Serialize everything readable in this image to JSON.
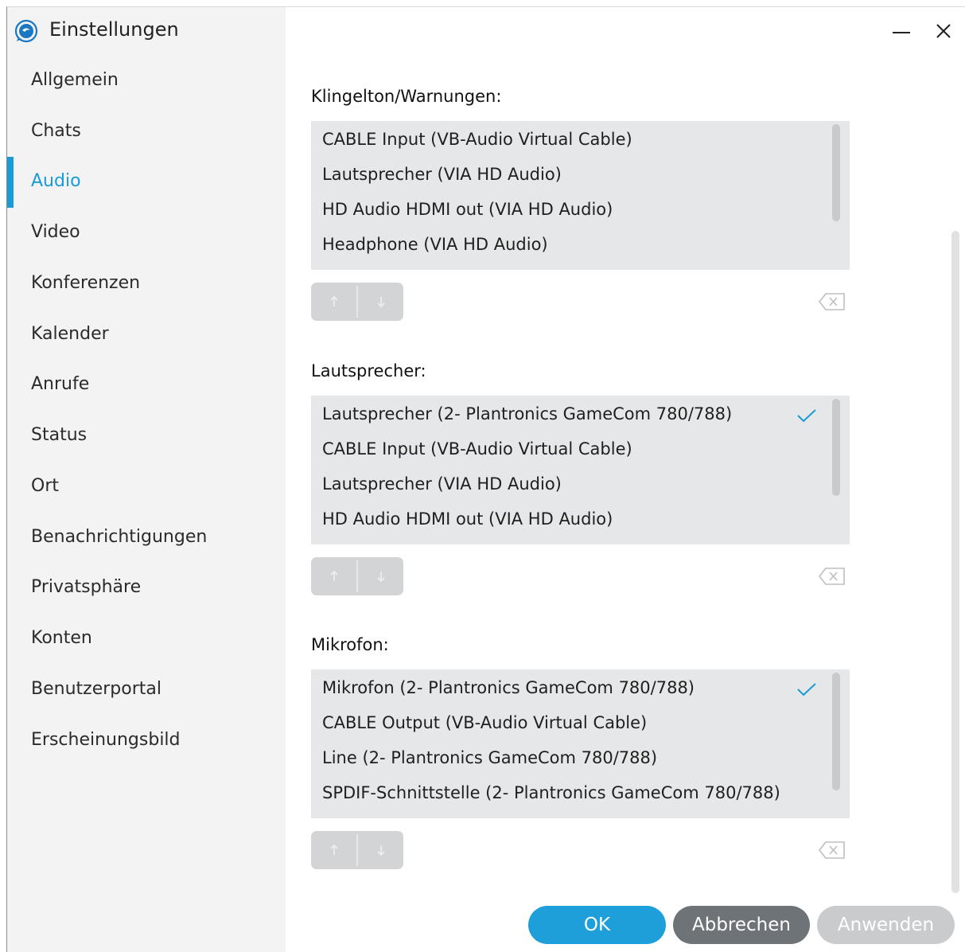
{
  "window": {
    "title": "Einstellungen"
  },
  "sidebar": {
    "items": [
      {
        "label": "Allgemein"
      },
      {
        "label": "Chats"
      },
      {
        "label": "Audio",
        "active": true
      },
      {
        "label": "Video"
      },
      {
        "label": "Konferenzen"
      },
      {
        "label": "Kalender"
      },
      {
        "label": "Anrufe"
      },
      {
        "label": "Status"
      },
      {
        "label": "Ort"
      },
      {
        "label": "Benachrichtigungen"
      },
      {
        "label": "Privatsphäre"
      },
      {
        "label": "Konten"
      },
      {
        "label": "Benutzerportal"
      },
      {
        "label": "Erscheinungsbild"
      }
    ]
  },
  "sections": {
    "ringtone": {
      "label": "Klingelton/Warnungen:",
      "devices": [
        "CABLE Input (VB-Audio Virtual Cable)",
        "Lautsprecher (VIA HD Audio)",
        "HD Audio HDMI out (VIA HD Audio)",
        "Headphone (VIA HD Audio)"
      ],
      "selected_index": null
    },
    "speaker": {
      "label": "Lautsprecher:",
      "devices": [
        "Lautsprecher (2- Plantronics GameCom 780/788)",
        "CABLE Input (VB-Audio Virtual Cable)",
        "Lautsprecher (VIA HD Audio)",
        "HD Audio HDMI out (VIA HD Audio)"
      ],
      "selected_index": 0
    },
    "microphone": {
      "label": "Mikrofon:",
      "devices": [
        "Mikrofon (2- Plantronics GameCom 780/788)",
        "CABLE Output (VB-Audio Virtual Cable)",
        "Line (2- Plantronics GameCom 780/788)",
        "SPDIF-Schnittstelle (2- Plantronics GameCom 780/788)"
      ],
      "selected_index": 0
    }
  },
  "footer": {
    "ok_label": "OK",
    "cancel_label": "Abbrechen",
    "apply_label": "Anwenden"
  },
  "colors": {
    "accent": "#1a9bd7",
    "check": "#1a9bd7"
  },
  "icons": {
    "app": "app-logo-icon",
    "minimize": "minimize-icon",
    "close": "close-icon",
    "up": "arrow-up-icon",
    "down": "arrow-down-icon",
    "delete": "backspace-delete-icon",
    "selected": "checkmark-icon"
  }
}
